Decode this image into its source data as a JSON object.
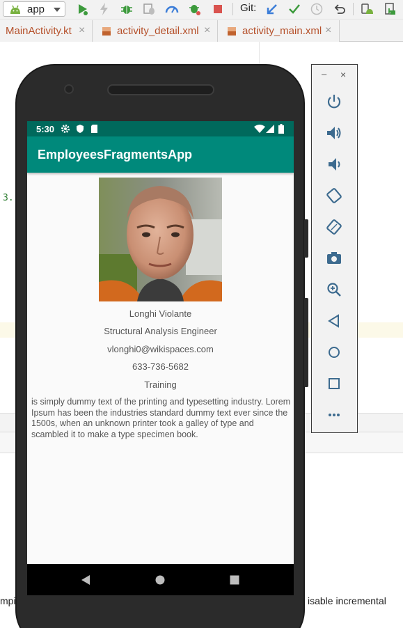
{
  "toolbar": {
    "run_config": "app",
    "git_label": "Git:"
  },
  "tabs": [
    {
      "label": "MainActivity.kt"
    },
    {
      "label": "activity_detail.xml"
    },
    {
      "label": "activity_main.xml"
    }
  ],
  "editor": {
    "code_fragment": "3.",
    "bottom_left_text": "mpi",
    "bottom_right_text": "isable incremental"
  },
  "device": {
    "status_time": "5:30",
    "app_title": "EmployeesFragmentsApp",
    "employee": {
      "name": "Longhi Violante",
      "title": "Structural Analysis Engineer",
      "email": "vlonghi0@wikispaces.com",
      "phone": "633-736-5682",
      "department": "Training",
      "bio": "is simply dummy text of the printing and typesetting industry. Lorem Ipsum has been the industries standard dummy text ever since the 1500s, when an unknown printer took a galley of type and scambled it to make a type specimen book."
    }
  },
  "emulator_panel": {
    "minimize": "–",
    "close": "×",
    "buttons": [
      "power",
      "volume-up",
      "volume-down",
      "rotate-left",
      "rotate-right",
      "screenshot",
      "zoom",
      "back",
      "home",
      "overview",
      "more"
    ]
  },
  "colors": {
    "app_bar": "#00897b",
    "status_bar": "#00695c",
    "tab_text": "#b5502a"
  }
}
